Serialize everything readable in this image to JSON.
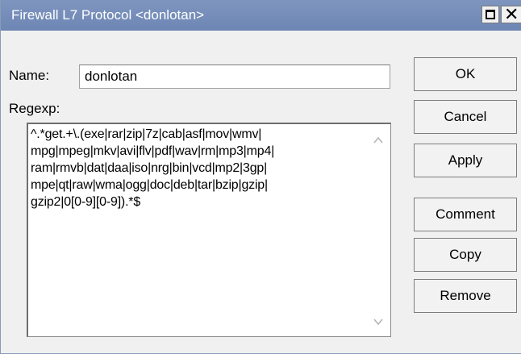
{
  "window": {
    "title": "Firewall L7 Protocol <donlotan>"
  },
  "form": {
    "name_label": "Name:",
    "name_value": "donlotan",
    "regexp_label": "Regexp:",
    "regexp_value": "^.*get.+\\.(exe|rar|zip|7z|cab|asf|mov|wmv|\nmpg|mpeg|mkv|avi|flv|pdf|wav|rm|mp3|mp4|\nram|rmvb|dat|daa|iso|nrg|bin|vcd|mp2|3gp|\nmpe|qt|raw|wma|ogg|doc|deb|tar|bzip|gzip|\ngzip2|0[0-9][0-9]).*$"
  },
  "buttons": {
    "ok": "OK",
    "cancel": "Cancel",
    "apply": "Apply",
    "comment": "Comment",
    "copy": "Copy",
    "remove": "Remove"
  },
  "icons": {
    "maximize": "maximize-icon",
    "close": "close-icon",
    "scroll_up": "arrow-up-icon",
    "scroll_down": "arrow-down-icon"
  },
  "colors": {
    "titlebar": "#7089b6",
    "background": "#f0f0f0"
  }
}
